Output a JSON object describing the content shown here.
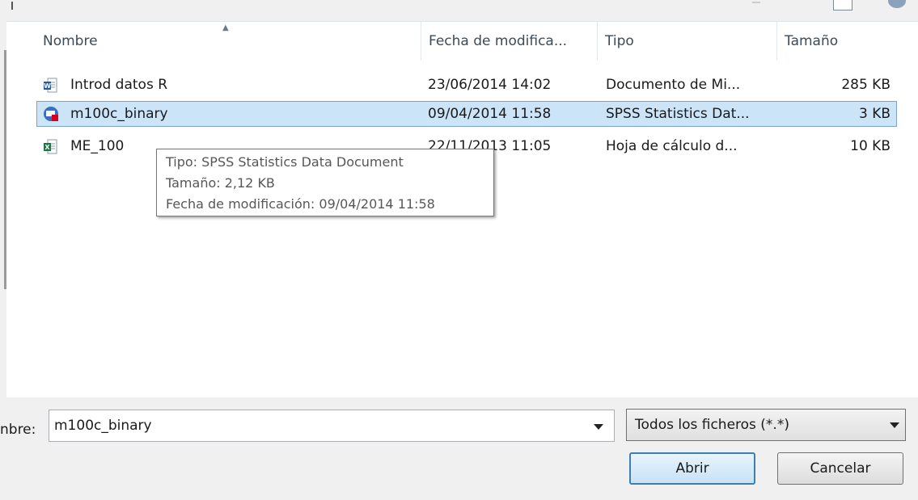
{
  "columns": {
    "name": "Nombre",
    "modified": "Fecha de modifica...",
    "type": "Tipo",
    "size": "Tamaño"
  },
  "files": [
    {
      "name": "Introd datos R",
      "modified": "23/06/2014 14:02",
      "type": "Documento de Mi...",
      "size": "285 KB",
      "icon": "word-document-icon"
    },
    {
      "name": "m100c_binary",
      "modified": "09/04/2014 11:58",
      "type": "SPSS Statistics Dat...",
      "size": "3 KB",
      "icon": "spss-data-icon",
      "selected": true
    },
    {
      "name": "ME_100",
      "modified": "22/11/2013 11:05",
      "type": "Hoja de cálculo d...",
      "size": "10 KB",
      "icon": "excel-spreadsheet-icon"
    }
  ],
  "tooltip": {
    "type": "Tipo: SPSS Statistics Data Document",
    "size": "Tamaño: 2,12 KB",
    "modified": "Fecha de modificación: 09/04/2014 11:58"
  },
  "bottom": {
    "name_label": "nbre:",
    "filename_value": "m100c_binary",
    "filter_value": "Todos los ficheros (*.*)",
    "open_label": "Abrir",
    "cancel_label": "Cancelar"
  },
  "colors": {
    "selection_bg": "#cce4f7",
    "selection_border": "#7da2ce",
    "primary_button_border": "#3c7fb1",
    "word_blue": "#2b579a",
    "excel_green": "#217346",
    "spss_red": "#d9001b"
  }
}
